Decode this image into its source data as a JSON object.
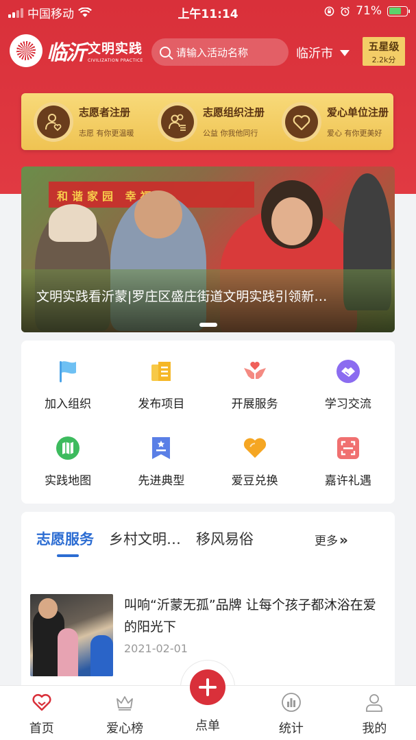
{
  "status_bar": {
    "carrier": "中国移动",
    "time": "上午11:14",
    "battery": "71%"
  },
  "header": {
    "logo_calligraphy": "临沂",
    "logo_cn": "文明实践",
    "logo_en": "CIVILIZATION PRACTICE",
    "search_placeholder": "请输入活动名称",
    "city": "临沂市",
    "level": "五星级",
    "points": "2.2k分"
  },
  "registration": [
    {
      "title": "志愿者注册",
      "subtitle": "志愿 有你更温暖",
      "icon": "volunteer-heart-icon"
    },
    {
      "title": "志愿组织注册",
      "subtitle": "公益 你我他同行",
      "icon": "organization-group-icon"
    },
    {
      "title": "爱心单位注册",
      "subtitle": "爱心 有你更美好",
      "icon": "heart-icon"
    }
  ],
  "banner": {
    "title": "文明实践看沂蒙|罗庄区盛庄街道文明实践引领新…",
    "sign_text": "和谐家园 幸福",
    "slide_count": 1
  },
  "menu": [
    {
      "label": "加入组织",
      "icon": "flag-icon",
      "color": "#4aa3e8"
    },
    {
      "label": "发布项目",
      "icon": "document-icon",
      "color": "#f5b727"
    },
    {
      "label": "开展服务",
      "icon": "hands-heart-icon",
      "color": "#f0605a"
    },
    {
      "label": "学习交流",
      "icon": "handshake-icon",
      "color": "#8b6cf0"
    },
    {
      "label": "实践地图",
      "icon": "map-icon",
      "color": "#3dbb5e"
    },
    {
      "label": "先进典型",
      "icon": "bookmark-star-icon",
      "color": "#5a7fe6"
    },
    {
      "label": "爱豆兑换",
      "icon": "heart-exchange-icon",
      "color": "#f5a623"
    },
    {
      "label": "嘉许礼遇",
      "icon": "scan-frame-icon",
      "color": "#f07070"
    }
  ],
  "news": {
    "tabs": [
      "志愿服务",
      "乡村文明…",
      "移风易俗"
    ],
    "active_tab": 0,
    "more_label": "更多",
    "item": {
      "title": "叫响“沂蒙无孤”品牌 让每个孩子都沐浴在爱的阳光下",
      "date": "2021-02-01"
    }
  },
  "tabbar": {
    "items": [
      {
        "label": "首页",
        "icon": "home-heart-icon"
      },
      {
        "label": "爱心榜",
        "icon": "crown-icon"
      },
      {
        "label": "点单",
        "icon": "plus-icon"
      },
      {
        "label": "统计",
        "icon": "chart-icon"
      },
      {
        "label": "我的",
        "icon": "profile-icon"
      }
    ],
    "active": 0
  },
  "colors": {
    "brand_red": "#d9303a",
    "gold": "#f3cd67",
    "active_blue": "#2b6cd2"
  }
}
